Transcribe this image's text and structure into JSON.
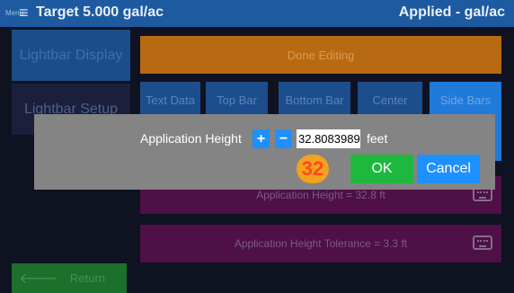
{
  "header": {
    "menu_label": "Menu",
    "menu_icon": "hamburger-icon",
    "target": "Target 5.000 gal/ac",
    "applied": "Applied - gal/ac"
  },
  "sidebar": {
    "lightbar_display": "Lightbar Display",
    "lightbar_setup": "Lightbar Setup",
    "return_label": "Return",
    "return_icon": "arrow-left-icon"
  },
  "main": {
    "done_editing": "Done Editing",
    "tabs": [
      "Text Data",
      "Top Bar",
      "Bottom Bar",
      "Center",
      "Side Bars"
    ],
    "settings": [
      {
        "label": "Application Height = 32.8 ft",
        "icon": "keyboard-icon"
      },
      {
        "label": "Application Height Tolerance = 3.3 ft",
        "icon": "keyboard-icon"
      }
    ]
  },
  "dialog": {
    "label": "Application Height",
    "plus": "+",
    "minus": "−",
    "value": "32.8083989",
    "units": "feet",
    "badge": "32",
    "ok": "OK",
    "cancel": "Cancel"
  },
  "colors": {
    "header_bg": "#1d5aa0",
    "done_bg": "#b86a12",
    "tab_bg": "#1c4e8e",
    "setting_bg": "#4e1047",
    "dialog_bg": "#848484",
    "ok_bg": "#1fb83f",
    "cancel_bg": "#1e90ff",
    "badge_bg": "#f2a21e"
  }
}
